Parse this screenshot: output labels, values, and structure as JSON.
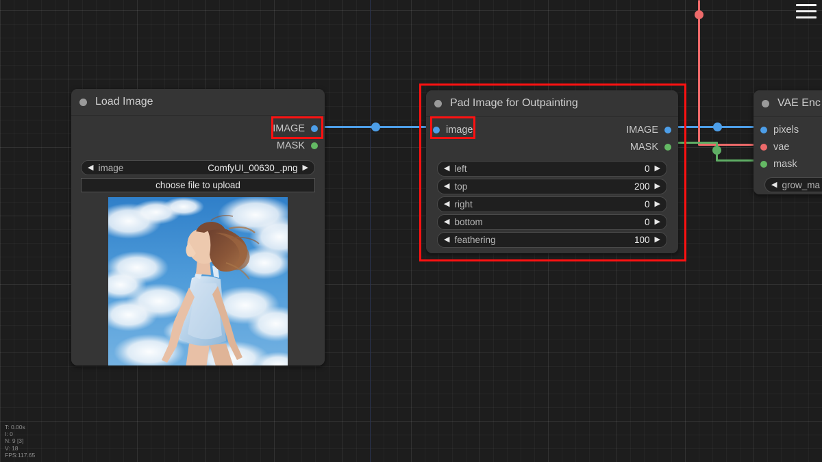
{
  "app": {
    "menu_icon": "hamburger-icon"
  },
  "stats": {
    "time": "T: 0.00s",
    "iterations": "I: 0",
    "nodes": "N: 9 [3]",
    "vertices": "V: 18",
    "fps": "FPS:117.65"
  },
  "colors": {
    "image_slot": "#4d9ee8",
    "mask_slot": "#64b964",
    "vae_slot": "#ed6a6a",
    "annotation": "#ff1111",
    "node_bg": "#353535",
    "canvas_bg": "#1d1d1d"
  },
  "nodes": [
    {
      "id": "load-image",
      "title": "Load Image",
      "outputs": [
        {
          "label": "IMAGE",
          "color": "#4d9ee8"
        },
        {
          "label": "MASK",
          "color": "#64b964"
        }
      ],
      "widgets": [
        {
          "type": "combo",
          "name": "image",
          "value": "ComfyUI_00630_.png"
        }
      ],
      "button": "choose file to upload"
    },
    {
      "id": "pad-image-for-outpainting",
      "title": "Pad Image for Outpainting",
      "inputs": [
        {
          "label": "image",
          "color": "#4d9ee8"
        }
      ],
      "outputs": [
        {
          "label": "IMAGE",
          "color": "#4d9ee8"
        },
        {
          "label": "MASK",
          "color": "#64b964"
        }
      ],
      "widgets": [
        {
          "type": "number",
          "name": "left",
          "value": "0"
        },
        {
          "type": "number",
          "name": "top",
          "value": "200"
        },
        {
          "type": "number",
          "name": "right",
          "value": "0"
        },
        {
          "type": "number",
          "name": "bottom",
          "value": "0"
        },
        {
          "type": "number",
          "name": "feathering",
          "value": "100"
        }
      ]
    },
    {
      "id": "vae-encode",
      "title": "VAE Enc",
      "inputs": [
        {
          "label": "pixels",
          "color": "#4d9ee8"
        },
        {
          "label": "vae",
          "color": "#ed6a6a"
        },
        {
          "label": "mask",
          "color": "#64b964"
        }
      ],
      "widgets": [
        {
          "type": "combo",
          "name": "grow_ma",
          "value": ""
        }
      ]
    }
  ],
  "arrows": {
    "left": "◀",
    "right": "▶"
  }
}
